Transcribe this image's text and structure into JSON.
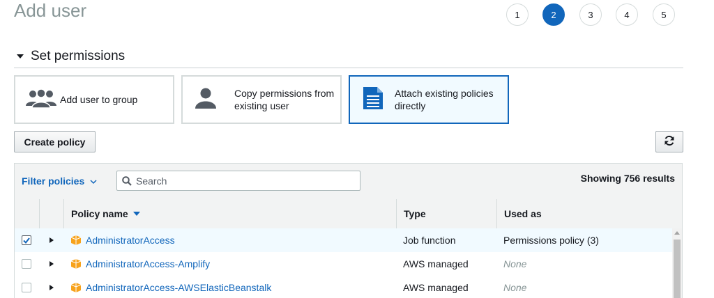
{
  "page": {
    "title": "Add user"
  },
  "steps": [
    "1",
    "2",
    "3",
    "4",
    "5"
  ],
  "active_step": "2",
  "section": {
    "title": "Set permissions"
  },
  "options": {
    "add_to_group": "Add user to group",
    "copy_line1": "Copy permissions from",
    "copy_line2": "existing user",
    "attach_line1": "Attach existing policies",
    "attach_line2": "directly"
  },
  "toolbar": {
    "create_policy": "Create policy"
  },
  "filter": {
    "label": "Filter policies",
    "search_placeholder": "Search",
    "results": "Showing 756 results"
  },
  "table": {
    "headers": {
      "policy_name": "Policy name",
      "type": "Type",
      "used_as": "Used as"
    },
    "rows": [
      {
        "name": "AdministratorAccess",
        "type": "Job function",
        "used_as": "Permissions policy (3)",
        "checked": true
      },
      {
        "name": "AdministratorAccess-Amplify",
        "type": "AWS managed",
        "used_as": "None",
        "checked": false
      },
      {
        "name": "AdministratorAccess-AWSElasticBeanstalk",
        "type": "AWS managed",
        "used_as": "None",
        "checked": false
      }
    ]
  },
  "colors": {
    "accent": "#1166bb",
    "selected_bg": "#f1faff",
    "policy_icon": "#f7a21b"
  }
}
